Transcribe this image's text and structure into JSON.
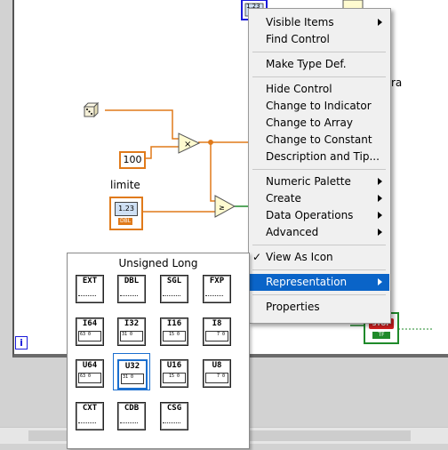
{
  "diagram": {
    "control_label": "limite",
    "constant_value": "100",
    "control_display": "1.23",
    "control_type": "DBL",
    "top_indicator_display": "1.23",
    "partial_text": "ra",
    "stop_label": "STOP",
    "stop_type": "TF",
    "info_icon": "i"
  },
  "context_menu": {
    "items": [
      {
        "label": "Visible Items",
        "submenu": true
      },
      {
        "label": "Find Control",
        "submenu": false
      },
      {
        "label": "Make Type Def.",
        "submenu": false
      },
      {
        "label": "Hide Control",
        "submenu": false
      },
      {
        "label": "Change to Indicator",
        "submenu": false
      },
      {
        "label": "Change to Array",
        "submenu": false
      },
      {
        "label": "Change to Constant",
        "submenu": false
      },
      {
        "label": "Description and Tip...",
        "submenu": false
      },
      {
        "label": "Numeric Palette",
        "submenu": true
      },
      {
        "label": "Create",
        "submenu": true
      },
      {
        "label": "Data Operations",
        "submenu": true
      },
      {
        "label": "Advanced",
        "submenu": true
      },
      {
        "label": "View As Icon",
        "submenu": false,
        "checked": true
      },
      {
        "label": "Representation",
        "submenu": true,
        "highlighted": true
      },
      {
        "label": "Properties",
        "submenu": false
      }
    ],
    "highlight_color": "#0a64c8"
  },
  "representation_palette": {
    "title": "Unsigned Long",
    "selected": "U32",
    "types": [
      {
        "label": "EXT",
        "bits": ""
      },
      {
        "label": "DBL",
        "bits": ""
      },
      {
        "label": "SGL",
        "bits": ""
      },
      {
        "label": "FXP",
        "bits": ""
      },
      {
        "label": "I64",
        "bits": "63 0"
      },
      {
        "label": "I32",
        "bits": "31 0"
      },
      {
        "label": "I16",
        "bits": "15 0"
      },
      {
        "label": "I8",
        "bits": "7 0"
      },
      {
        "label": "U64",
        "bits": "63 0"
      },
      {
        "label": "U32",
        "bits": "31 0"
      },
      {
        "label": "U16",
        "bits": "15 0"
      },
      {
        "label": "U8",
        "bits": "7 0"
      },
      {
        "label": "CXT",
        "bits": ""
      },
      {
        "label": "CDB",
        "bits": ""
      },
      {
        "label": "CSG",
        "bits": ""
      }
    ]
  },
  "colors": {
    "wire_orange": "#e07a1a",
    "bool_green": "#1f8a2a",
    "selection_blue": "#1b6fcf"
  }
}
